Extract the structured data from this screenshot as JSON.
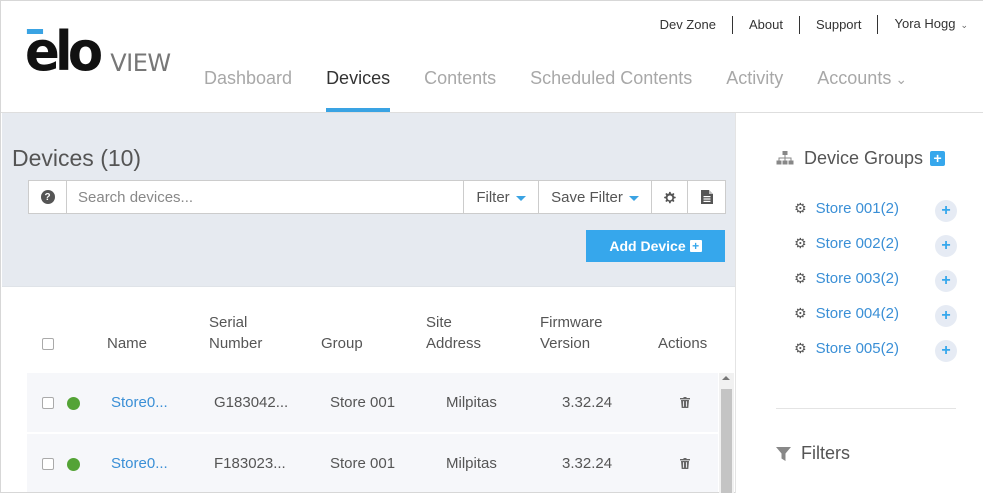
{
  "brand": {
    "logo_main": "elo",
    "logo_sub": "VIEW"
  },
  "toplinks": [
    {
      "label": "Dev Zone"
    },
    {
      "label": "About"
    },
    {
      "label": "Support"
    },
    {
      "label": "Yora Hogg"
    }
  ],
  "nav": [
    {
      "label": "Dashboard"
    },
    {
      "label": "Devices"
    },
    {
      "label": "Contents"
    },
    {
      "label": "Scheduled Contents"
    },
    {
      "label": "Activity"
    },
    {
      "label": "Accounts"
    }
  ],
  "devices": {
    "title": "Devices (10)",
    "search_placeholder": "Search devices...",
    "filter_label": "Filter",
    "save_filter_label": "Save Filter",
    "add_device_label": "Add Device"
  },
  "table": {
    "headers": {
      "name": "Name",
      "serial_1": "Serial",
      "serial_2": "Number",
      "group": "Group",
      "site_1": "Site",
      "site_2": "Address",
      "firmware_1": "Firmware",
      "firmware_2": "Version",
      "actions": "Actions"
    },
    "rows": [
      {
        "name": "Store0...",
        "serial": "G183042...",
        "group": "Store 001",
        "site": "Milpitas",
        "firmware": "3.32.24"
      },
      {
        "name": "Store0...",
        "serial": "F183023...",
        "group": "Store 001",
        "site": "Milpitas",
        "firmware": "3.32.24"
      }
    ]
  },
  "device_groups": {
    "title": "Device Groups",
    "items": [
      {
        "label": "Store 001(2)"
      },
      {
        "label": "Store 002(2)"
      },
      {
        "label": "Store 003(2)"
      },
      {
        "label": "Store 004(2)"
      },
      {
        "label": "Store 005(2)"
      }
    ]
  },
  "filters": {
    "title": "Filters"
  },
  "colors": {
    "accent": "#36a7ec",
    "status_online": "#54a336",
    "panel_bg": "#e6eaf0"
  }
}
